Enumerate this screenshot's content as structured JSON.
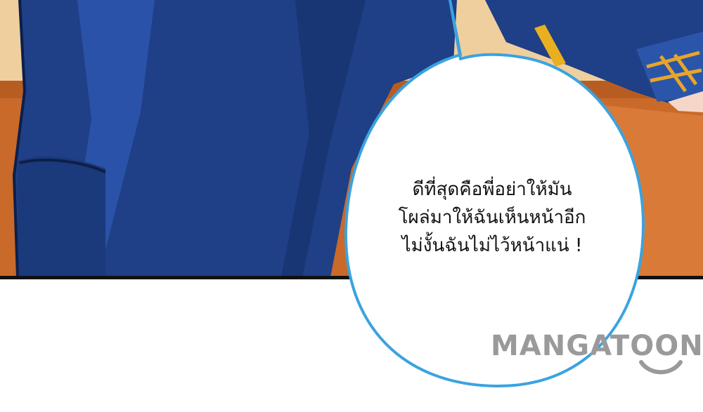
{
  "speech_bubble": {
    "lines": [
      "ดีที่สุดคือพี่อย่าให้มัน",
      "โผล่มาให้ฉันเห็นหน้าอีก",
      "ไม่งั้นฉันไม่ไว้หน้าแน่ !"
    ]
  },
  "watermark": {
    "text": "MANGATOON"
  },
  "colors": {
    "wall": "#f0cf9e",
    "desk": "#c96a2a",
    "suit": "#1f3f86",
    "bubble_outline": "#3aa3e0",
    "watermark": "#9a9a9a"
  }
}
